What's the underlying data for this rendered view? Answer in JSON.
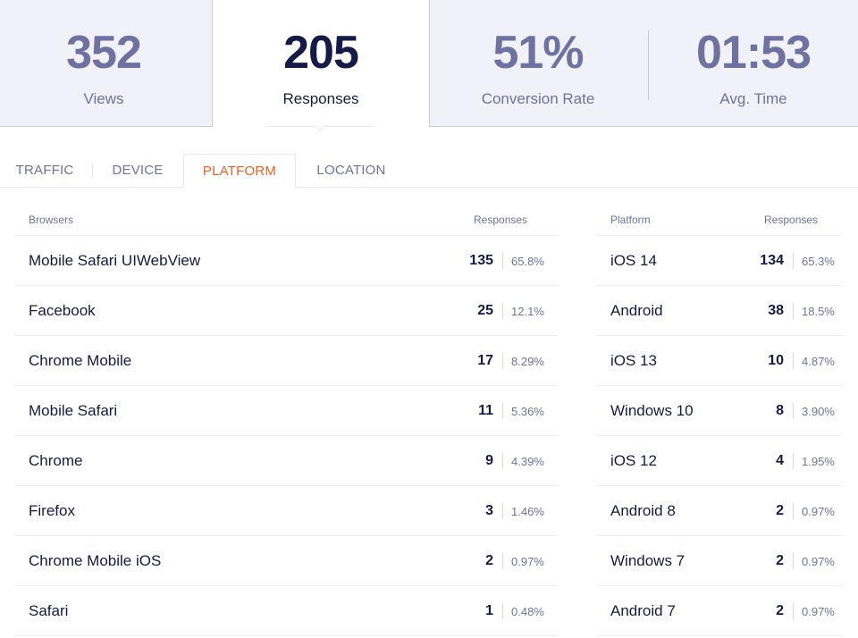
{
  "stats": {
    "views": {
      "value": "352",
      "label": "Views"
    },
    "responses": {
      "value": "205",
      "label": "Responses"
    },
    "conversion": {
      "value": "51%",
      "label": "Conversion Rate"
    },
    "avg_time": {
      "value": "01:53",
      "label": "Avg. Time"
    }
  },
  "tabs": [
    {
      "label": "TRAFFIC",
      "active": false
    },
    {
      "label": "DEVICE",
      "active": false
    },
    {
      "label": "PLATFORM",
      "active": true
    },
    {
      "label": "LOCATION",
      "active": false
    }
  ],
  "browsers": {
    "header_name": "Browsers",
    "header_responses": "Responses",
    "rows": [
      {
        "name": "Mobile Safari UIWebView",
        "count": "135",
        "pct": "65.8%"
      },
      {
        "name": "Facebook",
        "count": "25",
        "pct": "12.1%"
      },
      {
        "name": "Chrome Mobile",
        "count": "17",
        "pct": "8.29%"
      },
      {
        "name": "Mobile Safari",
        "count": "11",
        "pct": "5.36%"
      },
      {
        "name": "Chrome",
        "count": "9",
        "pct": "4.39%"
      },
      {
        "name": "Firefox",
        "count": "3",
        "pct": "1.46%"
      },
      {
        "name": "Chrome Mobile iOS",
        "count": "2",
        "pct": "0.97%"
      },
      {
        "name": "Safari",
        "count": "1",
        "pct": "0.48%"
      }
    ]
  },
  "platforms": {
    "header_name": "Platform",
    "header_responses": "Responses",
    "rows": [
      {
        "name": "iOS 14",
        "count": "134",
        "pct": "65.3%"
      },
      {
        "name": "Android",
        "count": "38",
        "pct": "18.5%"
      },
      {
        "name": "iOS 13",
        "count": "10",
        "pct": "4.87%"
      },
      {
        "name": "Windows 10",
        "count": "8",
        "pct": "3.90%"
      },
      {
        "name": "iOS 12",
        "count": "4",
        "pct": "1.95%"
      },
      {
        "name": "Android 8",
        "count": "2",
        "pct": "0.97%"
      },
      {
        "name": "Windows 7",
        "count": "2",
        "pct": "0.97%"
      },
      {
        "name": "Android 7",
        "count": "2",
        "pct": "0.97%"
      }
    ]
  },
  "colors": {
    "accent": "#e8622a",
    "navy": "#151a47",
    "muted": "#6f71a1",
    "card_bg": "#f1f1f9"
  }
}
